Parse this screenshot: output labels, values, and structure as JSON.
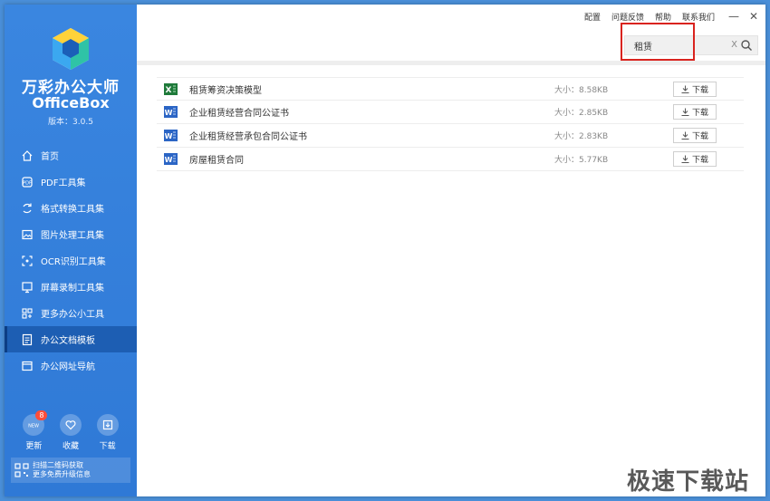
{
  "app": {
    "name_cn": "万彩办公大师",
    "name_en": "OfficeBox",
    "version": "版本：3.0.5"
  },
  "sidebar": {
    "items": [
      {
        "label": "首页",
        "icon": "home-icon",
        "active": false
      },
      {
        "label": "PDF工具集",
        "icon": "pdf-icon",
        "active": false
      },
      {
        "label": "格式转换工具集",
        "icon": "convert-icon",
        "active": false
      },
      {
        "label": "图片处理工具集",
        "icon": "image-icon",
        "active": false
      },
      {
        "label": "OCR识别工具集",
        "icon": "ocr-icon",
        "active": false
      },
      {
        "label": "屏幕录制工具集",
        "icon": "screen-icon",
        "active": false
      },
      {
        "label": "更多办公小工具",
        "icon": "grid-icon",
        "active": false
      },
      {
        "label": "办公文档模板",
        "icon": "document-icon",
        "active": true
      },
      {
        "label": "办公网址导航",
        "icon": "browser-icon",
        "active": false
      }
    ],
    "bottom": {
      "update": {
        "label": "更新",
        "badge": "8"
      },
      "favorite": {
        "label": "收藏"
      },
      "download": {
        "label": "下载"
      }
    },
    "qr": {
      "line1": "扫描二维码获取",
      "line2": "更多免费升级信息"
    }
  },
  "topbar": {
    "links": [
      "配置",
      "问题反馈",
      "帮助",
      "联系我们"
    ],
    "minimize": "—",
    "close": "✕"
  },
  "search": {
    "value": "租赁",
    "clear": "X"
  },
  "files": [
    {
      "name": "租赁筹资决策模型",
      "type": "excel",
      "size": "大小：8.58KB",
      "action": "下载"
    },
    {
      "name": "企业租赁经营合同公证书",
      "type": "word",
      "size": "大小：2.85KB",
      "action": "下载"
    },
    {
      "name": "企业租赁经营承包合同公证书",
      "type": "word",
      "size": "大小：2.83KB",
      "action": "下载"
    },
    {
      "name": "房屋租赁合同",
      "type": "word",
      "size": "大小：5.77KB",
      "action": "下载"
    }
  ],
  "watermark": "极速下载站",
  "colors": {
    "sidebar": "#3a86e0",
    "active": "#1d5eb3",
    "highlight": "#d9231e",
    "excel": "#1f7a3a",
    "word": "#2b65c5"
  }
}
